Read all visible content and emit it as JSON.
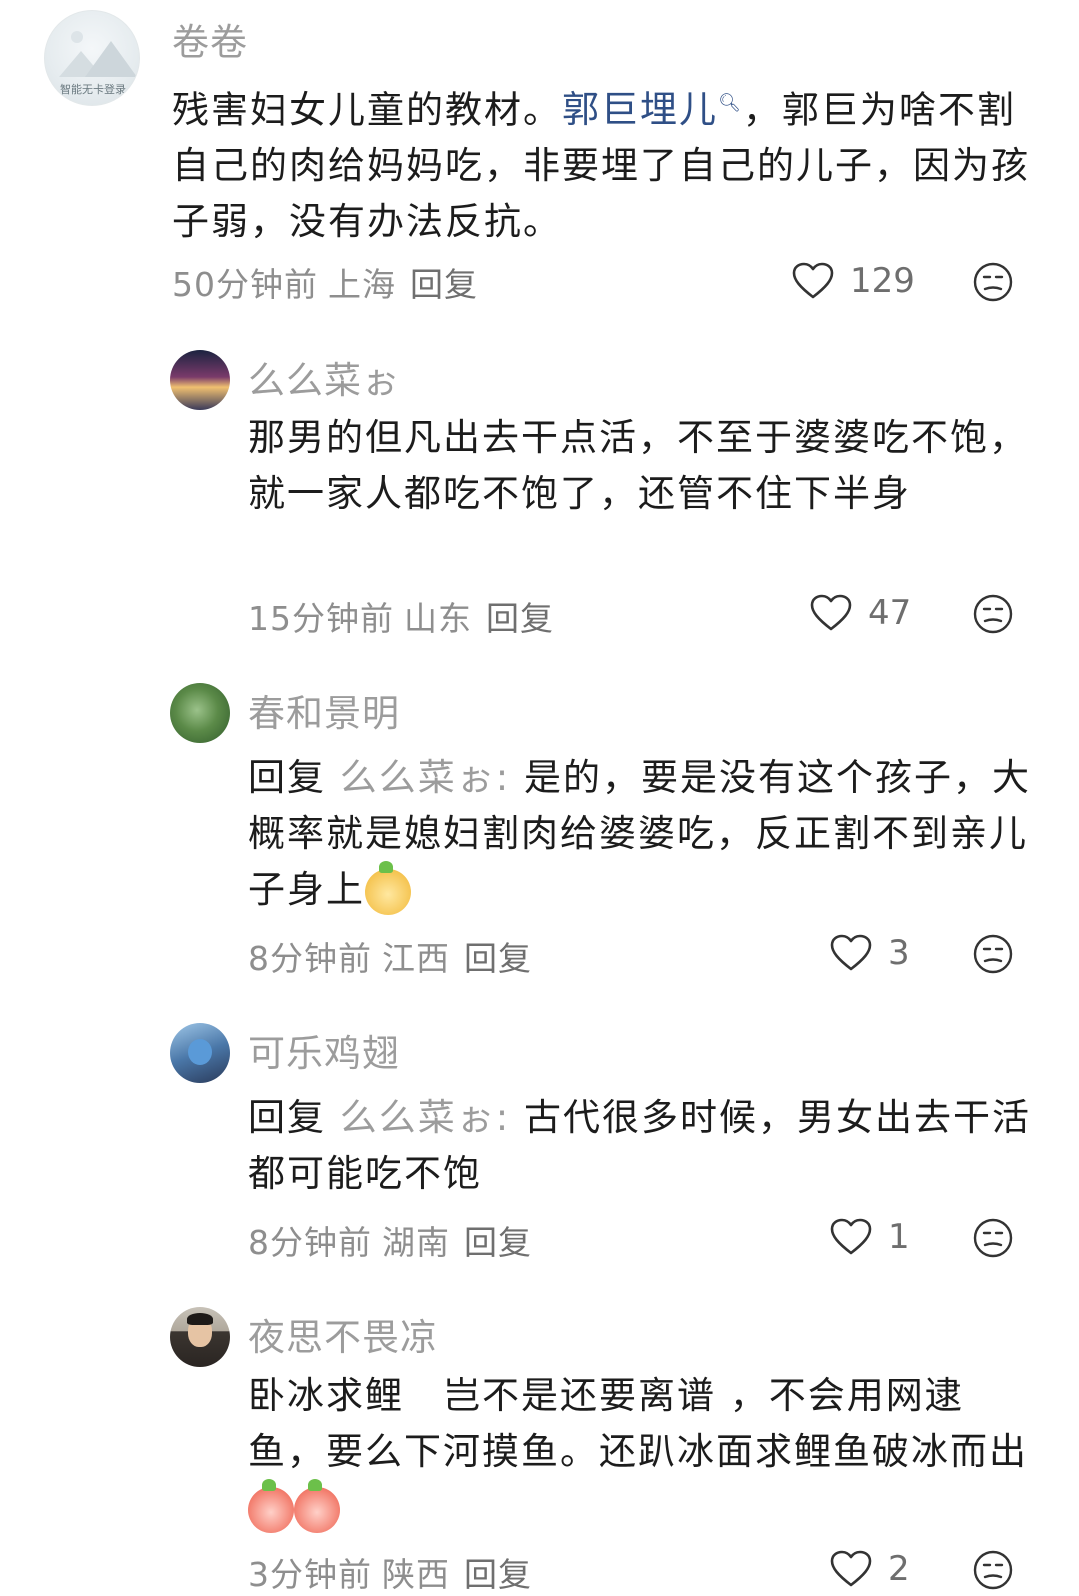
{
  "comments": [
    {
      "username": "卷卷",
      "avatar_text": "智能无卡登录",
      "text_before": "残害妇女儿童的教材。",
      "link_text": "郭巨埋儿",
      "text_after": "，郭巨为啥不割自己的肉给妈妈吃，非要埋了自己的儿子，因为孩子弱，没有办法反抗。",
      "time": "50分钟前",
      "location": "上海",
      "reply_label": "回复",
      "likes": "129"
    },
    {
      "username": "么么菜ぉ",
      "text": "那男的但凡出去干点活，不至于婆婆吃不饱，就一家人都吃不饱了，还管不住下半身",
      "time": "15分钟前",
      "location": "山东",
      "reply_label": "回复",
      "likes": "47"
    },
    {
      "username": "春和景明",
      "reply_prefix": "回复",
      "reply_target": "么么菜ぉ:",
      "text": "是的，要是没有这个孩子，大概率就是媳妇割肉给婆婆吃，反正割不到亲儿子身上",
      "time": "8分钟前",
      "location": "江西",
      "reply_label": "回复",
      "likes": "3"
    },
    {
      "username": "可乐鸡翅",
      "reply_prefix": "回复",
      "reply_target": "么么菜ぉ:",
      "text": "古代很多时候，男女出去干活都可能吃不饱",
      "time": "8分钟前",
      "location": "湖南",
      "reply_label": "回复",
      "likes": "1"
    },
    {
      "username": "夜思不畏凉",
      "text": "卧冰求鲤　岂不是还要离谱 ，不会用网逮鱼，要么下河摸鱼。还趴冰面求鲤鱼破冰而出",
      "time": "3分钟前",
      "location": "陕西",
      "reply_label": "回复",
      "likes": "2"
    }
  ],
  "icons": {
    "like": "heart-outline-icon",
    "dislike": "meh-face-icon",
    "link_search": "search-icon"
  },
  "colors": {
    "link": "#2f4f86",
    "meta": "#8e8e8e",
    "username": "#9c9c9c"
  }
}
